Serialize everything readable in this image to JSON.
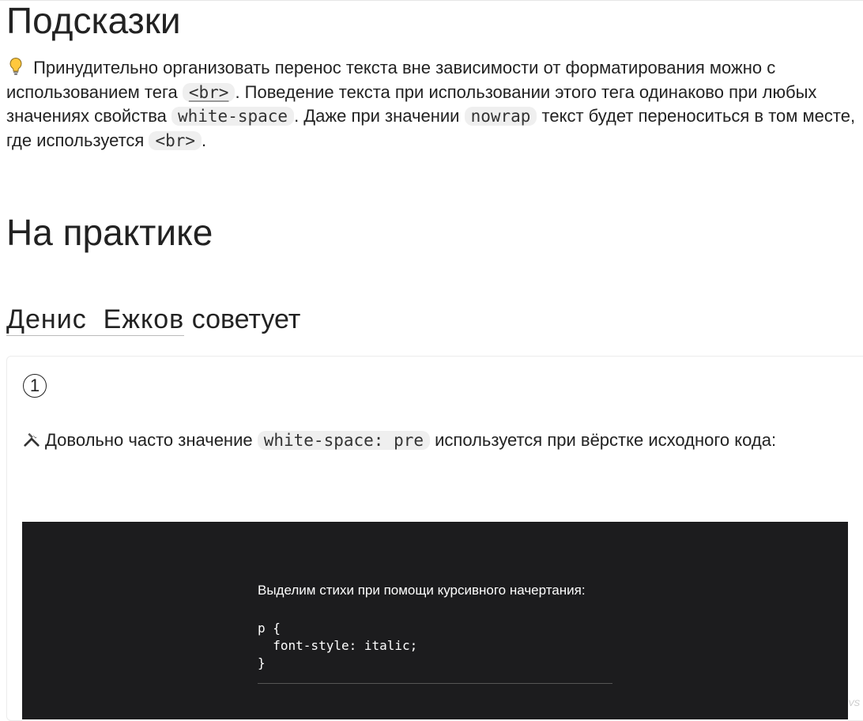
{
  "hints": {
    "title": "Подсказки",
    "text_1": " Принудительно организовать перенос текста вне зависимости от форматирования можно с использованием тега ",
    "code_br": "<br>",
    "text_2": ". Поведение текста при использовании этого тега одинаково при любых значениях свойства ",
    "code_ws": "white-space",
    "text_3": ". Даже при значении ",
    "code_nowrap": "nowrap",
    "text_4": " текст будет переноситься в том месте, где используется ",
    "text_5": "."
  },
  "practice": {
    "title": "На практике",
    "author": "Денис  Ежков",
    "advises": " советует",
    "card": {
      "number": "1",
      "text_1": "Довольно часто значение ",
      "code": "white-space: pre",
      "text_2": " используется при вёрстке исходного кода:",
      "demo": {
        "intro": "Выделим стихи при помощи курсивного начертания:",
        "code": "p {\n  font-style: italic;\n}"
      }
    }
  },
  "corner_mark": "VS",
  "icons": {
    "hint": "lightbulb-icon",
    "tip": "hammer-wrench-icon"
  },
  "colors": {
    "code_bg": "#efefef",
    "demo_bg": "#1c1c1e"
  }
}
